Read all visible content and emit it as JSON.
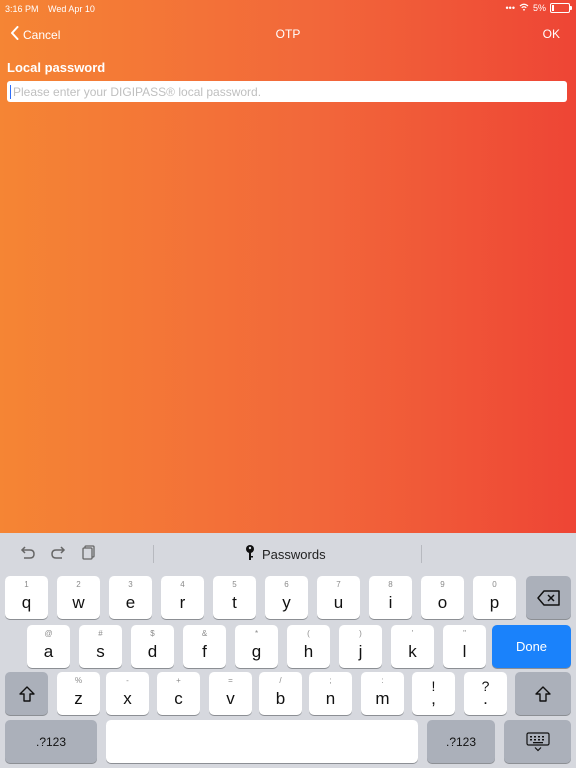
{
  "status_bar": {
    "time": "3:16 PM",
    "date": "Wed Apr 10",
    "battery": "5%"
  },
  "nav": {
    "cancel_label": "Cancel",
    "title": "OTP",
    "ok_label": "OK"
  },
  "form": {
    "label": "Local password",
    "placeholder": "Please enter your DIGIPASS® local password.",
    "value": ""
  },
  "keyboard": {
    "toolbar": {
      "passwords_label": "Passwords"
    },
    "row1": [
      {
        "main": "q",
        "sec": "1"
      },
      {
        "main": "w",
        "sec": "2"
      },
      {
        "main": "e",
        "sec": "3"
      },
      {
        "main": "r",
        "sec": "4"
      },
      {
        "main": "t",
        "sec": "5"
      },
      {
        "main": "y",
        "sec": "6"
      },
      {
        "main": "u",
        "sec": "7"
      },
      {
        "main": "i",
        "sec": "8"
      },
      {
        "main": "o",
        "sec": "9"
      },
      {
        "main": "p",
        "sec": "0"
      }
    ],
    "row2": [
      {
        "main": "a",
        "sec": "@"
      },
      {
        "main": "s",
        "sec": "#"
      },
      {
        "main": "d",
        "sec": "$"
      },
      {
        "main": "f",
        "sec": "&"
      },
      {
        "main": "g",
        "sec": "*"
      },
      {
        "main": "h",
        "sec": "("
      },
      {
        "main": "j",
        "sec": ")"
      },
      {
        "main": "k",
        "sec": "'"
      },
      {
        "main": "l",
        "sec": "\""
      }
    ],
    "row3": [
      {
        "main": "z",
        "sec": "%"
      },
      {
        "main": "x",
        "sec": "-"
      },
      {
        "main": "c",
        "sec": "+"
      },
      {
        "main": "v",
        "sec": "="
      },
      {
        "main": "b",
        "sec": "/"
      },
      {
        "main": "n",
        "sec": ";"
      },
      {
        "main": "m",
        "sec": ":"
      },
      {
        "main": ",",
        "sec": "!"
      },
      {
        "main": ".",
        "sec": "?"
      }
    ],
    "done_label": "Done",
    "numbers_label": ".?123"
  },
  "colors": {
    "accent_blue": "#1a82fb",
    "gradient_left": "#f58534",
    "gradient_right": "#ee4535"
  },
  "icons": [
    "chevron-left-icon",
    "undo-icon",
    "redo-icon",
    "paste-icon",
    "key-icon",
    "backspace-icon",
    "shift-icon",
    "keyboard-dismiss-icon"
  ]
}
